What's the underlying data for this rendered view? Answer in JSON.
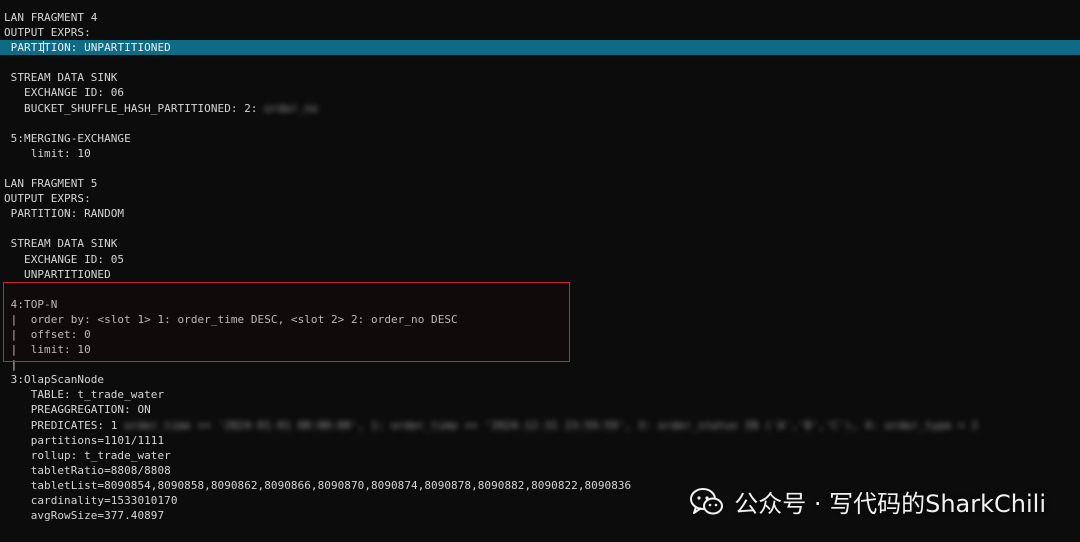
{
  "terminal": {
    "lines": [
      {
        "text": "LAN FRAGMENT 4"
      },
      {
        "text": "OUTPUT EXPRS:"
      },
      {
        "text": " PARTITION: UNPARTITIONED",
        "highlight": true
      },
      {
        "text": ""
      },
      {
        "text": " STREAM DATA SINK"
      },
      {
        "text": "   EXCHANGE ID: 06"
      },
      {
        "text": "   BUCKET_SHUFFLE_HASH_PARTITIONED: 2: ",
        "redacted": "order_no"
      },
      {
        "text": ""
      },
      {
        "text": " 5:MERGING-EXCHANGE"
      },
      {
        "text": "    limit: 10"
      },
      {
        "text": ""
      },
      {
        "text": "LAN FRAGMENT 5"
      },
      {
        "text": "OUTPUT EXPRS:"
      },
      {
        "text": " PARTITION: RANDOM"
      },
      {
        "text": ""
      },
      {
        "text": " STREAM DATA SINK"
      },
      {
        "text": "   EXCHANGE ID: 05"
      },
      {
        "text": "   UNPARTITIONED"
      },
      {
        "text": ""
      },
      {
        "text": " 4:TOP-N"
      },
      {
        "text": " |  order by: <slot 1> 1: order_time DESC, <slot 2> 2: order_no DESC"
      },
      {
        "text": " |  offset: 0"
      },
      {
        "text": " |  limit: 10"
      },
      {
        "text": " |"
      },
      {
        "text": " 3:OlapScanNode"
      },
      {
        "text": "    TABLE: t_trade_water"
      },
      {
        "text": "    PREAGGREGATION: ON"
      },
      {
        "text": "    PREDICATES: 1",
        "redacted": " order_time >= '2024-01-01 00:00:00', 1: order_time <= '2024-12-31 23:59:59', 3: order_status IN ('A','B','C'), 4: order_type = 2"
      },
      {
        "text": "    partitions=1101/1111"
      },
      {
        "text": "    rollup: t_trade_water"
      },
      {
        "text": "    tabletRatio=8808/8808"
      },
      {
        "text": "    tabletList=8090854,8090858,8090862,8090866,8090870,8090874,8090878,8090882,8090822,8090836"
      },
      {
        "text": "    cardinality=1533010170"
      },
      {
        "text": "    avgRowSize=377.40897"
      }
    ]
  },
  "watermark": {
    "text": "公众号 · 写代码的SharkChili",
    "icon": "wechat-icon"
  },
  "colors": {
    "background": "#0c0c0c",
    "text": "#d6d6d6",
    "highlight": "#0f6b83",
    "box": "#d0202a"
  }
}
